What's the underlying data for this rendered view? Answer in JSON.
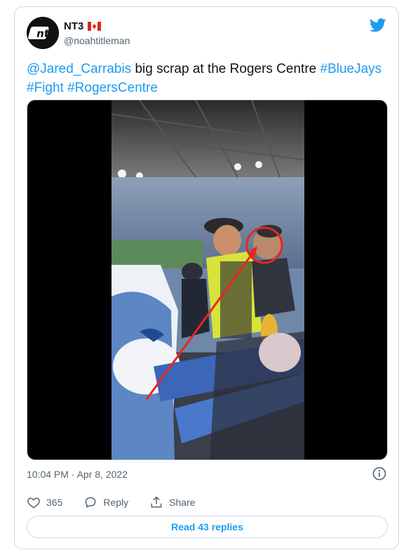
{
  "author": {
    "name": "NT3",
    "handle": "@noahtitleman",
    "avatar_text": "nt"
  },
  "tweet": {
    "mention": "@Jared_Carrabis",
    "text_plain": " big scrap at the Rogers Centre ",
    "hashtags": [
      "#BlueJays",
      "#Fight",
      "#RogersCentre"
    ]
  },
  "meta": {
    "timestamp": "10:04 PM · Apr 8, 2022"
  },
  "actions": {
    "likes_count": "365",
    "reply_label": "Reply",
    "share_label": "Share"
  },
  "read_replies_label": "Read 43 replies",
  "colors": {
    "accent": "#1d9bf0",
    "muted": "#536471",
    "border": "#cfd9de",
    "annotation_red": "#e8261f"
  },
  "icons": {
    "brand": "twitter-bird-icon",
    "info": "info-icon",
    "like": "heart-icon",
    "reply": "reply-bubble-icon",
    "share": "share-upload-icon",
    "flag": "canada-flag-icon"
  }
}
